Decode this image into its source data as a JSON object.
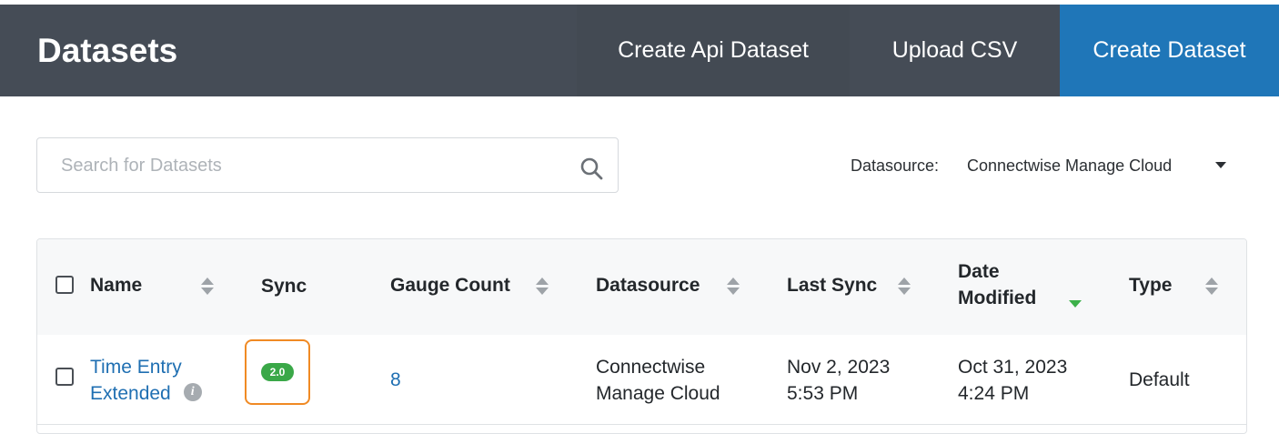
{
  "header": {
    "title": "Datasets",
    "buttons": {
      "create_api": "Create Api Dataset",
      "upload_csv": "Upload CSV",
      "create_dataset": "Create Dataset"
    }
  },
  "search": {
    "placeholder": "Search for Datasets",
    "value": "",
    "icon": "search-icon"
  },
  "filter": {
    "label": "Datasource:",
    "selected": "Connectwise Manage Cloud"
  },
  "table": {
    "columns": {
      "name": "Name",
      "sync": "Sync",
      "gauge_count": "Gauge Count",
      "datasource": "Datasource",
      "last_sync": "Last Sync",
      "date_modified_line1": "Date",
      "date_modified_line2": "Modified",
      "type": "Type"
    },
    "sorted_by": "Date Modified",
    "rows": [
      {
        "name_line1": "Time Entry",
        "name_line2": "Extended",
        "sync_badge": "2.0",
        "gauge_count": "8",
        "datasource_line1": "Connectwise",
        "datasource_line2": "Manage Cloud",
        "last_sync_line1": "Nov 2, 2023",
        "last_sync_line2": "5:53 PM",
        "date_modified_line1": "Oct 31, 2023",
        "date_modified_line2": "4:24 PM",
        "type": "Default"
      }
    ]
  },
  "colors": {
    "header_bg": "#454c56",
    "primary_button": "#1f76b8",
    "link": "#1f6fb2",
    "sync_badge": "#3aa848",
    "highlight": "#f08a24",
    "sort_active": "#3cb04a"
  }
}
